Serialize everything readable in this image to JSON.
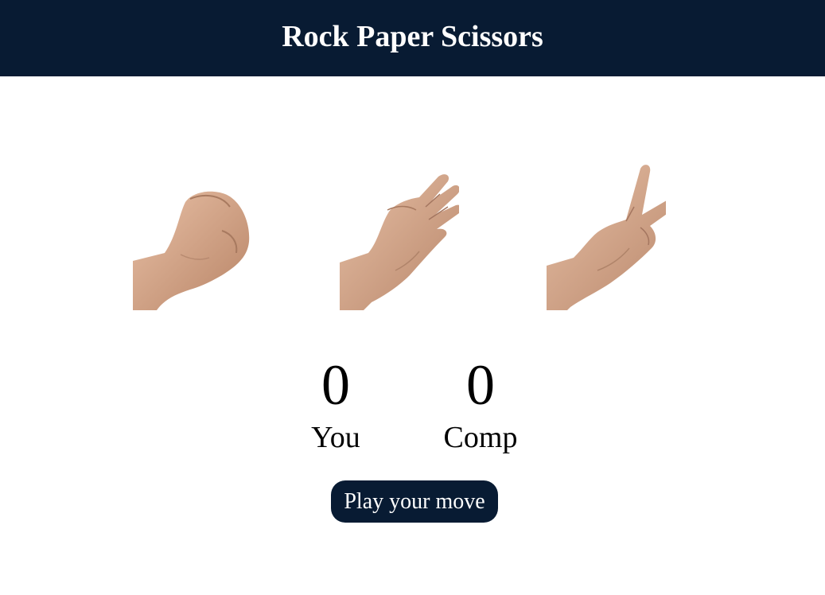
{
  "header": {
    "title": "Rock Paper Scissors"
  },
  "choices": [
    {
      "name": "rock",
      "icon": "rock-hand-icon"
    },
    {
      "name": "paper",
      "icon": "paper-hand-icon"
    },
    {
      "name": "scissors",
      "icon": "scissors-hand-icon"
    }
  ],
  "scoreboard": {
    "user": {
      "score": "0",
      "label": "You"
    },
    "comp": {
      "score": "0",
      "label": "Comp"
    }
  },
  "message": {
    "text": "Play your move"
  },
  "colors": {
    "header_bg": "#081b33",
    "button_bg": "#081b33",
    "skin": "#d9a98c"
  }
}
